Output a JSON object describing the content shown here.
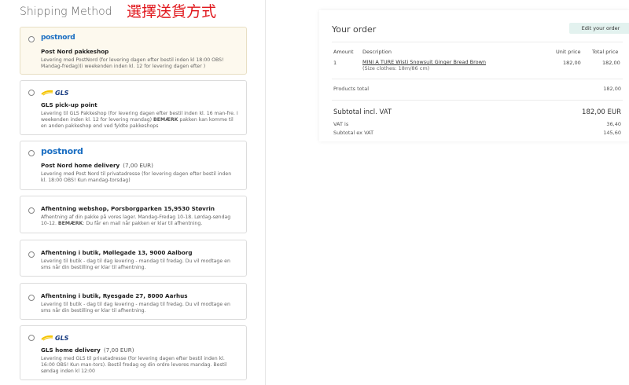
{
  "shipping": {
    "title": "Shipping Method",
    "annotation": "選擇送貨方式",
    "options": [
      {
        "logo": "postnord",
        "logo_text": "postnord",
        "name": "Post Nord pakkeshop",
        "price": "",
        "description": "Levering med PostNord (for levering dagen efter bestil inden kl 18:00 OBS! Mandag-fredag)(i weekenden inden kl. 12 for levering dagen efter )",
        "selected": true
      },
      {
        "logo": "gls",
        "logo_text": "GLS",
        "name": "GLS pick-up point",
        "price": "",
        "description_pre": "Levering til GLS Pakkeshop (for levering dagen efter bestil inden kl. 16 man-fre. I weekenden inden kl. 12 for levering mandag) ",
        "description_bold": "BEMÆRK",
        "description_post": " pakken kan komme til en anden pakkeshop end ved fyldte pakkeshops",
        "selected": false
      },
      {
        "logo": "postnord",
        "logo_text": "postnord",
        "name": "Post Nord home delivery",
        "price": "(7,00 EUR)",
        "description": "Levering med Post Nord til privatadresse (for levering dagen efter bestil inden kl. 18:00 OBS! Kun mandag-torsdag)",
        "selected": false
      },
      {
        "logo": "none",
        "name": "Afhentning webshop, Porsborgparken 15,9530 Støvrin",
        "price": "",
        "description_pre": "Afhentning af din pakke på vores lager. Mandag-Fredag 10-18. Lørdag-søndag 10-12. ",
        "description_bold": "BEMÆRK",
        "description_post": ": Du får en mail når pakken er klar til afhentning.",
        "selected": false
      },
      {
        "logo": "none",
        "name": "Afhentning i butik, Møllegade 13, 9000 Aalborg",
        "price": "",
        "description": "Levering til butik - dag til dag levering - mandag til fredag. Du vil modtage en sms når din bestilling er klar til afhentning.",
        "selected": false
      },
      {
        "logo": "none",
        "name": "Afhentning i butik, Ryesgade 27, 8000 Aarhus",
        "price": "",
        "description": "Levering til butik - dag til dag levering - mandag til fredag. Du vil modtage en sms når din bestilling er klar til afhentning.",
        "selected": false
      },
      {
        "logo": "gls",
        "logo_text": "GLS",
        "name": "GLS home delivery",
        "price": "(7,00 EUR)",
        "description": "Levering med GLS til privatadresse (for levering dagen efter bestil inden kl. 16:00 OBS! Kun man-tors). Bestil fredag og din ordre leveres mandag. Bestil søndag inden kl 12:00",
        "selected": false
      }
    ]
  },
  "order": {
    "title": "Your order",
    "edit_label": "Edit your order",
    "columns": {
      "amount": "Amount",
      "description": "Description",
      "unit_price": "Unit price",
      "total_price": "Total price"
    },
    "items": [
      {
        "amount": "1",
        "name": "MINI A TURE Wisti Snowsuit Ginger Bread Brown",
        "variant": "(Size clothes: 18m/86 cm)",
        "unit_price": "182,00",
        "total_price": "182,00"
      }
    ],
    "products_total_label": "Products total",
    "products_total_value": "182,00",
    "subtotal_label": "Subtotal incl. VAT",
    "subtotal_value": "182,00 EUR",
    "vat_label": "VAT is",
    "vat_value": "36,40",
    "ex_vat_label": "Subtotal ex VAT",
    "ex_vat_value": "145,60"
  },
  "colors": {
    "selected_bg": "#fdf9ee",
    "postnord_blue": "#1a6ec2",
    "gls_blue": "#15397f",
    "gls_yellow": "#f5c400",
    "edit_button_bg": "#e3f2ef",
    "annotation_red": "#e0161b"
  }
}
